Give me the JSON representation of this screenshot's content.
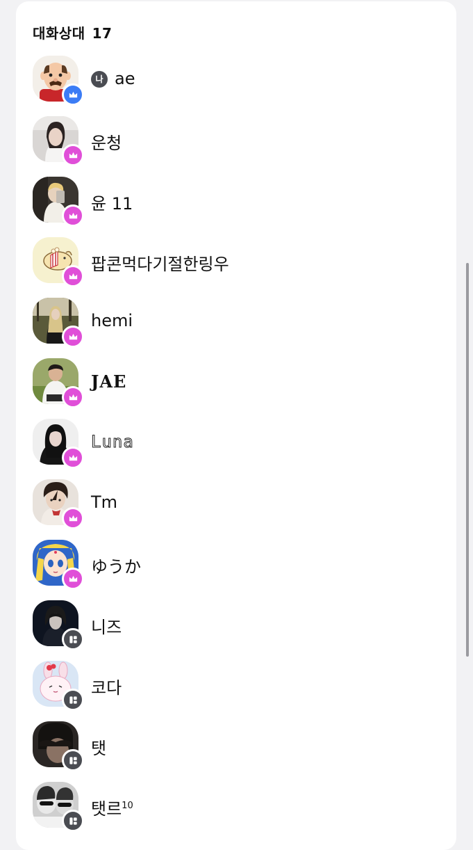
{
  "section": {
    "title": "대화상대",
    "count": "17"
  },
  "me_tag": "나",
  "contacts": [
    {
      "name": "ae",
      "badge": "crown",
      "badge_color": "#3b7cf5",
      "is_me": true
    },
    {
      "name": "운청",
      "badge": "crown",
      "badge_color": "#e04fd8"
    },
    {
      "name": "윤 11",
      "badge": "crown",
      "badge_color": "#e04fd8"
    },
    {
      "name": "팝콘먹다기절한링우",
      "badge": "crown",
      "badge_color": "#e04fd8"
    },
    {
      "name": "hemi",
      "badge": "crown",
      "badge_color": "#e04fd8"
    },
    {
      "name": "JAE",
      "badge": "crown",
      "badge_color": "#e04fd8"
    },
    {
      "name": "Luna",
      "badge": "crown",
      "badge_color": "#e04fd8"
    },
    {
      "name": "Tm",
      "badge": "crown",
      "badge_color": "#e04fd8"
    },
    {
      "name": "ゆうか",
      "badge": "crown",
      "badge_color": "#e04fd8"
    },
    {
      "name": "니즈",
      "badge": "tile",
      "badge_color": "#4a4c52"
    },
    {
      "name": "코다",
      "badge": "tile",
      "badge_color": "#4a4c52"
    },
    {
      "name": "탯",
      "badge": "tile",
      "badge_color": "#4a4c52"
    },
    {
      "name": "탯르",
      "name_sup": "10",
      "badge": "tile",
      "badge_color": "#4a4c52"
    }
  ]
}
